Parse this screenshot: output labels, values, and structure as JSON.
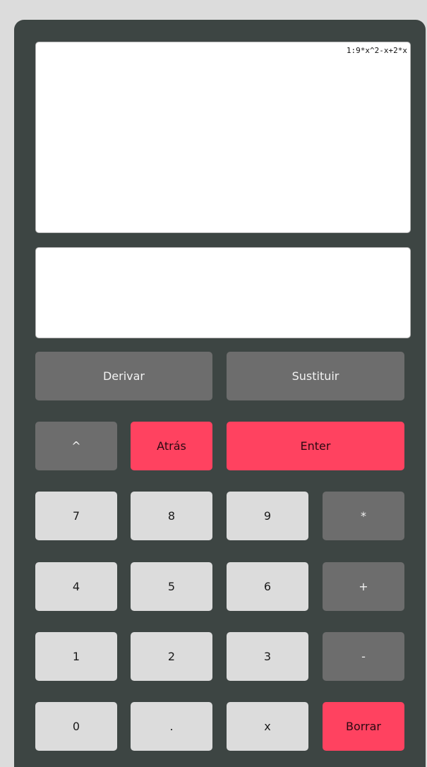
{
  "display": {
    "history_line": "1:9*x^2-x+2*x",
    "input_value": ""
  },
  "buttons": {
    "derivar": "Derivar",
    "sustituir": "Sustituir",
    "power": "^",
    "back": "Atrás",
    "enter": "Enter",
    "seven": "7",
    "eight": "8",
    "nine": "9",
    "multiply": "*",
    "four": "4",
    "five": "5",
    "six": "6",
    "plus": "+",
    "one": "1",
    "two": "2",
    "three": "3",
    "minus": "-",
    "zero": "0",
    "dot": ".",
    "x": "x",
    "clear": "Borrar"
  },
  "colors": {
    "body": "#3d4543",
    "button_dark": "#6d6d6d",
    "button_red": "#ff4260",
    "button_light": "#dcdcdc"
  }
}
